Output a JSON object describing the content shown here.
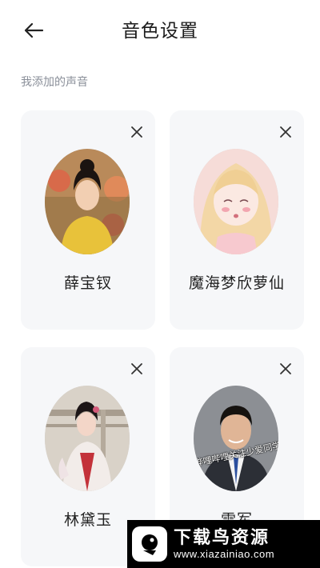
{
  "header": {
    "title": "音色设置",
    "back_icon": "arrow-left-icon"
  },
  "section_label": "我添加的声音",
  "voices": [
    {
      "name": "薛宝钗",
      "close_icon": "close-icon"
    },
    {
      "name": "魔海梦欣萝仙",
      "close_icon": "close-icon"
    },
    {
      "name": "林黛玉",
      "close_icon": "close-icon"
    },
    {
      "name": "雷军",
      "close_icon": "close-icon",
      "avatar_watermark": "哔哩哔哩关注少爱同学"
    }
  ],
  "badge": {
    "title": "下载鸟资源",
    "url": "www.xiazainiao.com"
  },
  "colors": {
    "card_bg": "#f6f7f9",
    "label": "#8a8f99"
  }
}
